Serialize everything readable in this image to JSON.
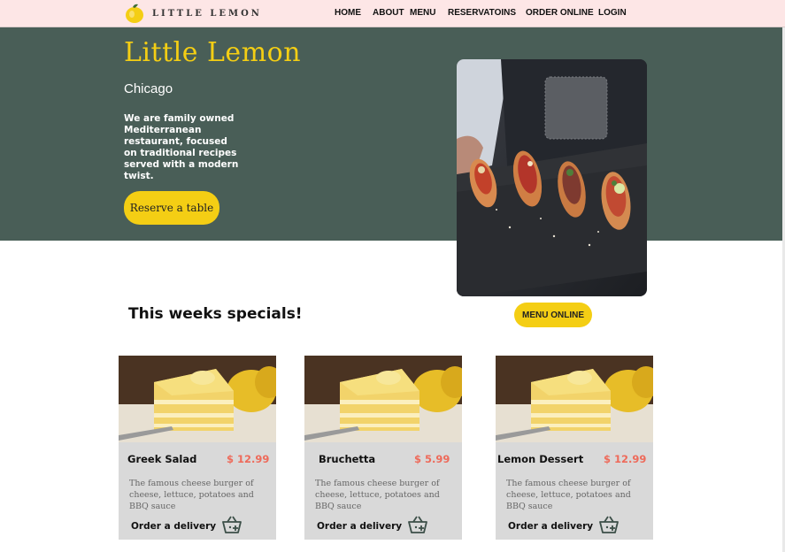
{
  "header": {
    "logo_text": "LITTLE LEMON",
    "nav": [
      "HOME",
      "ABOUT",
      "MENU",
      "RESERVATOINS",
      "ORDER ONLINE",
      "LOGIN"
    ]
  },
  "hero": {
    "title": "Little Lemon",
    "subtitle": "Chicago",
    "description": "We are family owned Mediterranean restaurant, focused on traditional recipes served with a modern twist.",
    "cta": "Reserve a table"
  },
  "specials": {
    "title": "This weeks specials!",
    "menu_button": "MENU ONLINE",
    "cards": [
      {
        "name": "Greek Salad",
        "price": "$ 12.99",
        "description": "The famous cheese burger of cheese, lettuce, potatoes and BBQ sauce",
        "order": "Order a delivery"
      },
      {
        "name": "Bruchetta",
        "price": "$ 5.99",
        "description": "The famous cheese burger of cheese, lettuce, potatoes and BBQ sauce",
        "order": "Order a delivery"
      },
      {
        "name": "Lemon Dessert",
        "price": "$ 12.99",
        "description": "The famous cheese burger of cheese, lettuce, potatoes and BBQ sauce",
        "order": "Order a delivery"
      }
    ]
  },
  "colors": {
    "header_bg": "#fde6e6",
    "hero_bg": "#495e57",
    "brand_yellow": "#f4ce14",
    "price_red": "#ee6a5a",
    "card_bg": "#d9d9d9"
  },
  "icons": [
    "lemon-logo-icon",
    "basket-add-icon"
  ]
}
